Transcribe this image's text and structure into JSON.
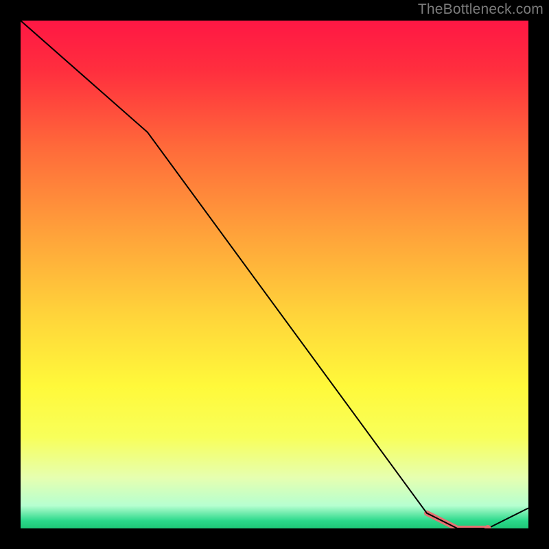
{
  "watermark": "TheBottleneck.com",
  "chart_data": {
    "type": "line",
    "title": "",
    "xlabel": "",
    "ylabel": "",
    "xlim": [
      0,
      100
    ],
    "ylim": [
      0,
      100
    ],
    "x": [
      0,
      25,
      80,
      86,
      92,
      100
    ],
    "values": [
      100,
      78,
      3,
      0,
      0,
      4
    ],
    "highlight_segments": [
      {
        "x1": 80,
        "y1": 3,
        "x2": 86,
        "y2": 0
      },
      {
        "x1": 86,
        "y1": 0,
        "x2": 92,
        "y2": 0
      }
    ],
    "highlight_points": [
      {
        "x": 92,
        "y": 0
      }
    ],
    "gradient_stops": [
      {
        "offset": 0.0,
        "color": "#ff1744"
      },
      {
        "offset": 0.1,
        "color": "#ff2f3e"
      },
      {
        "offset": 0.25,
        "color": "#ff6a3a"
      },
      {
        "offset": 0.42,
        "color": "#ffa23a"
      },
      {
        "offset": 0.58,
        "color": "#ffd43a"
      },
      {
        "offset": 0.72,
        "color": "#fff93a"
      },
      {
        "offset": 0.82,
        "color": "#f8ff5a"
      },
      {
        "offset": 0.9,
        "color": "#e6ffb0"
      },
      {
        "offset": 0.955,
        "color": "#b6ffd0"
      },
      {
        "offset": 0.985,
        "color": "#2bd98b"
      },
      {
        "offset": 1.0,
        "color": "#1ec777"
      }
    ],
    "highlight_color": "#e57373",
    "line_color": "#000000"
  }
}
